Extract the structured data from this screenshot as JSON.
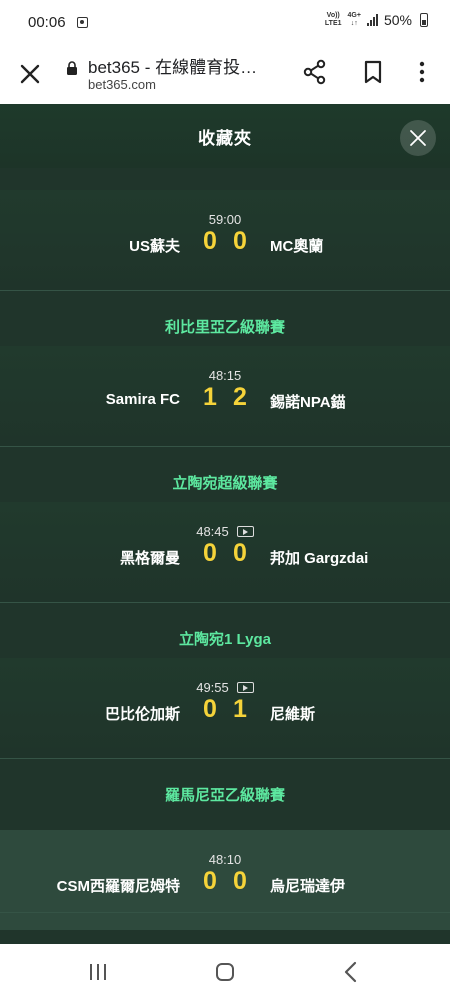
{
  "status_bar": {
    "time": "00:06",
    "network_top": "Vo))",
    "network_bottom": "LTE1",
    "data_top": "4G+",
    "data_bottom": "↓↑",
    "battery": "50%"
  },
  "browser": {
    "title": "bet365 - 在線體育投…",
    "url": "bet365.com"
  },
  "panel": {
    "title": "收藏夾"
  },
  "leagues": [
    {
      "name": "利比里亞乙級聯賽"
    },
    {
      "name": "立陶宛超級聯賽"
    },
    {
      "name": "立陶宛1 Lyga"
    },
    {
      "name": "羅馬尼亞乙級聯賽"
    }
  ],
  "matches": [
    {
      "time": "59:00",
      "home": "US蘇夫",
      "away": "MC奧蘭",
      "home_score": "0",
      "away_score": "0",
      "video": false
    },
    {
      "time": "48:15",
      "home": "Samira FC",
      "away": "錫諾NPA錨",
      "home_score": "1",
      "away_score": "2",
      "video": false
    },
    {
      "time": "48:45",
      "home": "黑格爾曼",
      "away": "邦加 Gargzdai",
      "home_score": "0",
      "away_score": "0",
      "video": true
    },
    {
      "time": "49:55",
      "home": "巴比伦加斯",
      "away": "尼維斯",
      "home_score": "0",
      "away_score": "1",
      "video": true
    },
    {
      "time": "48:10",
      "home": "CSM西羅爾尼姆特",
      "away": "烏尼瑞達伊",
      "home_score": "0",
      "away_score": "0",
      "video": false
    }
  ],
  "colors": {
    "panel_bg": "#20352b",
    "league_text": "#5de8a0",
    "score": "#f5d33a"
  },
  "icons": [
    "close-icon",
    "lock-icon",
    "share-icon",
    "bookmark-icon",
    "more-icon",
    "video-icon",
    "recent-apps-icon",
    "home-icon",
    "back-icon"
  ]
}
